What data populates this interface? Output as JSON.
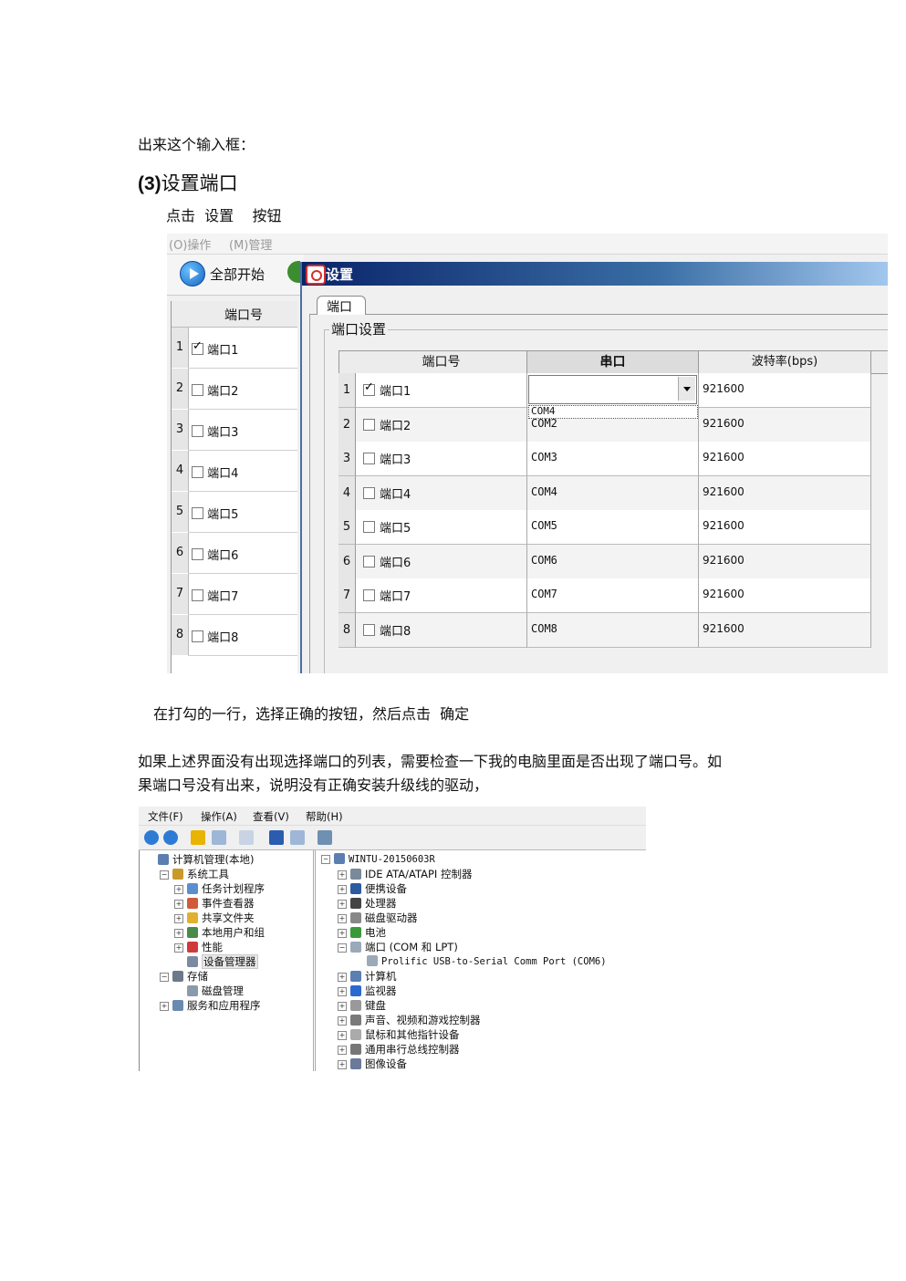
{
  "intro_text": "出来这个输入框：",
  "section": {
    "number": "(3)",
    "title": "设置端口"
  },
  "instruction": "点击  设置    按钮",
  "app": {
    "menu": [
      "(O)操作",
      "(M)管理"
    ],
    "toolbar_start_all": "全部开始",
    "left_grid": {
      "header": "端口号",
      "rows": [
        {
          "no": "1",
          "label": "端口1",
          "checked": true
        },
        {
          "no": "2",
          "label": "端口2",
          "checked": false
        },
        {
          "no": "3",
          "label": "端口3",
          "checked": false
        },
        {
          "no": "4",
          "label": "端口4",
          "checked": false
        },
        {
          "no": "5",
          "label": "端口5",
          "checked": false
        },
        {
          "no": "6",
          "label": "端口6",
          "checked": false
        },
        {
          "no": "7",
          "label": "端口7",
          "checked": false
        },
        {
          "no": "8",
          "label": "端口8",
          "checked": false
        }
      ]
    },
    "dialog": {
      "title": "设置",
      "tab": "端口",
      "group": "端口设置",
      "columns": [
        "端口号",
        "串口",
        "波特率(bps)"
      ],
      "dropdown_option": "COM4",
      "rows": [
        {
          "no": "1",
          "port": "端口1",
          "checked": true,
          "serial": "",
          "baud": "921600"
        },
        {
          "no": "2",
          "port": "端口2",
          "checked": false,
          "serial": "COM2",
          "baud": "921600"
        },
        {
          "no": "3",
          "port": "端口3",
          "checked": false,
          "serial": "COM3",
          "baud": "921600"
        },
        {
          "no": "4",
          "port": "端口4",
          "checked": false,
          "serial": "COM4",
          "baud": "921600"
        },
        {
          "no": "5",
          "port": "端口5",
          "checked": false,
          "serial": "COM5",
          "baud": "921600"
        },
        {
          "no": "6",
          "port": "端口6",
          "checked": false,
          "serial": "COM6",
          "baud": "921600"
        },
        {
          "no": "7",
          "port": "端口7",
          "checked": false,
          "serial": "COM7",
          "baud": "921600"
        },
        {
          "no": "8",
          "port": "端口8",
          "checked": false,
          "serial": "COM8",
          "baud": "921600"
        }
      ]
    }
  },
  "after_text": "在打勾的一行，选择正确的按钮，然后点击  确定",
  "paragraph": {
    "line1": "如果上述界面没有出现选择端口的列表，需要检查一下我的电脑里面是否出现了端口号。如",
    "line2": "果端口号没有出来，说明没有正确安装升级线的驱动，"
  },
  "computer_management": {
    "menu": [
      "文件(F)",
      "操作(A)",
      "查看(V)",
      "帮助(H)"
    ],
    "left_tree": [
      {
        "label": "计算机管理(本地)",
        "depth": 0,
        "icon": "computer-icon"
      },
      {
        "label": "系统工具",
        "depth": 1,
        "icon": "tools-icon",
        "exp": "−"
      },
      {
        "label": "任务计划程序",
        "depth": 2,
        "icon": "clock-icon",
        "exp": "+"
      },
      {
        "label": "事件查看器",
        "depth": 2,
        "icon": "event-icon",
        "exp": "+"
      },
      {
        "label": "共享文件夹",
        "depth": 2,
        "icon": "folder-icon",
        "exp": "+"
      },
      {
        "label": "本地用户和组",
        "depth": 2,
        "icon": "users-icon",
        "exp": "+"
      },
      {
        "label": "性能",
        "depth": 2,
        "icon": "performance-icon",
        "exp": "+"
      },
      {
        "label": "设备管理器",
        "depth": 2,
        "icon": "device-manager-icon",
        "selected": true
      },
      {
        "label": "存储",
        "depth": 1,
        "icon": "storage-icon",
        "exp": "−"
      },
      {
        "label": "磁盘管理",
        "depth": 2,
        "icon": "disk-icon"
      },
      {
        "label": "服务和应用程序",
        "depth": 1,
        "icon": "services-icon",
        "exp": "+"
      }
    ],
    "right_tree": [
      {
        "label": "WINTU-20150603R",
        "depth": 0,
        "icon": "computer-icon",
        "exp": "−"
      },
      {
        "label": "IDE ATA/ATAPI 控制器",
        "depth": 1,
        "icon": "ide-icon",
        "exp": "+"
      },
      {
        "label": "便携设备",
        "depth": 1,
        "icon": "portable-icon",
        "exp": "+"
      },
      {
        "label": "处理器",
        "depth": 1,
        "icon": "cpu-icon",
        "exp": "+"
      },
      {
        "label": "磁盘驱动器",
        "depth": 1,
        "icon": "disk-drive-icon",
        "exp": "+"
      },
      {
        "label": "电池",
        "depth": 1,
        "icon": "battery-icon",
        "exp": "+"
      },
      {
        "label": "端口 (COM 和 LPT)",
        "depth": 1,
        "icon": "port-icon",
        "exp": "−"
      },
      {
        "label": "Prolific USB-to-Serial Comm Port (COM6)",
        "depth": 2,
        "icon": "serial-port-icon"
      },
      {
        "label": "计算机",
        "depth": 1,
        "icon": "computer-icon",
        "exp": "+"
      },
      {
        "label": "监视器",
        "depth": 1,
        "icon": "monitor-icon",
        "exp": "+"
      },
      {
        "label": "键盘",
        "depth": 1,
        "icon": "keyboard-icon",
        "exp": "+"
      },
      {
        "label": "声音、视频和游戏控制器",
        "depth": 1,
        "icon": "sound-icon",
        "exp": "+"
      },
      {
        "label": "鼠标和其他指针设备",
        "depth": 1,
        "icon": "mouse-icon",
        "exp": "+"
      },
      {
        "label": "通用串行总线控制器",
        "depth": 1,
        "icon": "usb-icon",
        "exp": "+"
      },
      {
        "label": "图像设备",
        "depth": 1,
        "icon": "camera-icon",
        "exp": "+"
      }
    ]
  }
}
